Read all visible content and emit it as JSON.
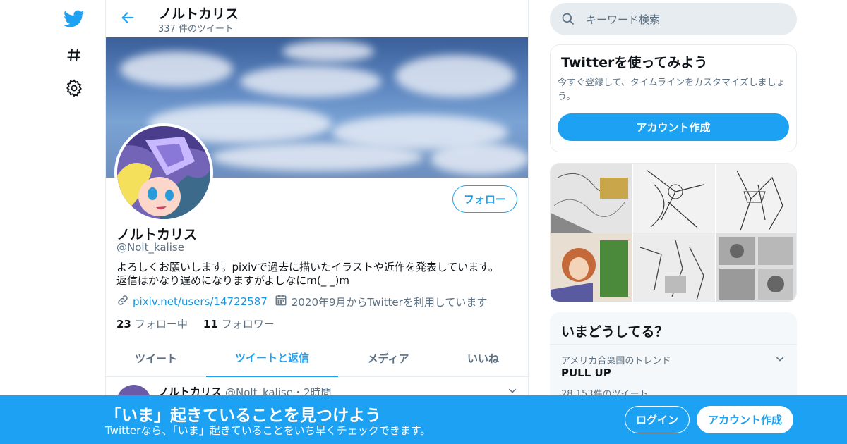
{
  "nav": {
    "icons": [
      "twitter-bird-icon",
      "hashtag-icon",
      "settings-gear-icon"
    ],
    "brand_color": "#1da1f2"
  },
  "header": {
    "title": "ノルトカリス",
    "subtitle": "337 件のツイート"
  },
  "profile": {
    "name": "ノルトカリス",
    "handle": "@Nolt_kalise",
    "follow_label": "フォロー",
    "bio_line1": "よろしくお願いします。pixivで過去に描いたイラストや近作を発表しています。",
    "bio_line2": "返信はかなり遅めになりますがよしなにm(_ _)m",
    "link": "pixiv.net/users/14722587",
    "joined": "2020年9月からTwitterを利用しています",
    "following_count": "23",
    "following_label": "フォロー中",
    "followers_count": "11",
    "followers_label": "フォロワー"
  },
  "tabs": [
    {
      "label": "ツイート",
      "active": false
    },
    {
      "label": "ツイートと返信",
      "active": true
    },
    {
      "label": "メディア",
      "active": false
    },
    {
      "label": "いいね",
      "active": false
    }
  ],
  "tweet_preview": {
    "name": "ノルトカリス",
    "meta": "@Nolt_kalise・2時間"
  },
  "search": {
    "placeholder": "キーワード検索"
  },
  "signup_card": {
    "title": "Twitterを使ってみよう",
    "description": "今すぐ登録して、タイムラインをカスタマイズしましょう。",
    "button": "アカウント作成"
  },
  "trends": {
    "title": "いまどうしてる？",
    "items": [
      {
        "context": "アメリカ合衆国のトレンド",
        "name": "PULL UP",
        "count": "28,153件のツイート"
      }
    ]
  },
  "bottom_bar": {
    "title": "「いま」起きていることを見つけよう",
    "subtitle": "Twitterなら、「いま」起きていることをいち早くチェックできます。",
    "login": "ログイン",
    "signup": "アカウント作成"
  }
}
